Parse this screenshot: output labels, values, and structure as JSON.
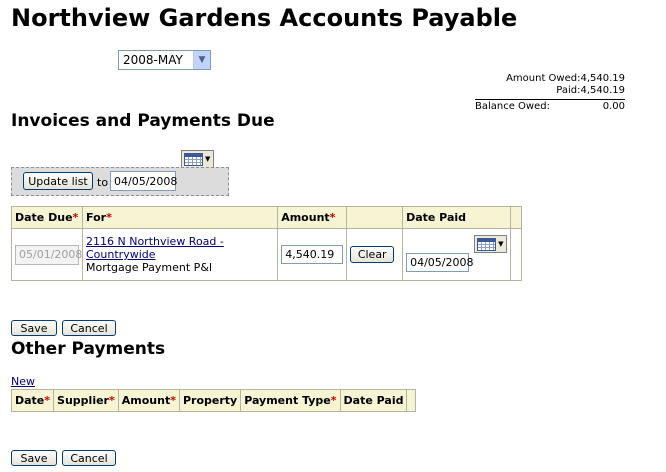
{
  "title": "Northview Gardens Accounts Payable",
  "month_select": {
    "value": "2008-MAY"
  },
  "summary": {
    "amount_owed_label": "Amount Owed:",
    "amount_owed": "4,540.19",
    "paid_label": "Paid:",
    "paid": "4,540.19",
    "balance_label": "Balance Owed:",
    "balance": "0.00"
  },
  "invoices": {
    "heading": "Invoices and Payments Due",
    "update_button": "Update list",
    "to_label": "to",
    "to_date": "04/05/2008",
    "columns": {
      "date_due": "Date Due",
      "for": "For",
      "amount": "Amount",
      "date_paid": "Date Paid"
    },
    "required_mark": "*",
    "rows": [
      {
        "date_due": "05/01/2008",
        "for_link": "2116 N Northview Road - Countrywide",
        "for_desc": "Mortgage Payment P&I",
        "amount": "4,540.19",
        "clear_label": "Clear",
        "date_paid": "04/05/2008"
      }
    ],
    "save_label": "Save",
    "cancel_label": "Cancel"
  },
  "other_payments": {
    "heading": "Other Payments",
    "new_link": "New",
    "columns": {
      "date": "Date",
      "supplier": "Supplier",
      "amount": "Amount",
      "property": "Property",
      "payment_type": "Payment Type",
      "date_paid": "Date Paid"
    },
    "save_label": "Save",
    "cancel_label": "Cancel"
  }
}
